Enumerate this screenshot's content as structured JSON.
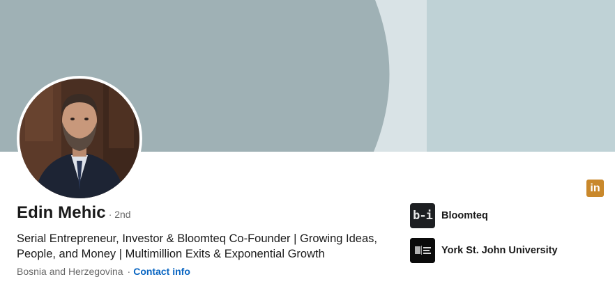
{
  "profile": {
    "name": "Edin Mehic",
    "degree": "· 2nd",
    "headline": "Serial Entrepreneur, Investor & Bloomteq Co-Founder | Growing Ideas, People, and Money | Multimillion Exits & Exponential Growth",
    "location": "Bosnia and Herzegovina",
    "separator": "·",
    "contact_label": "Contact info"
  },
  "badge": {
    "icon": "linkedin-icon",
    "text": "in",
    "color": "#c9882b"
  },
  "organizations": [
    {
      "name": "Bloomteq",
      "logo_icon": "bloomteq-logo",
      "logo_text": "b-i"
    },
    {
      "name": "York St. John University",
      "logo_icon": "york-st-john-logo",
      "logo_text": "YORK ST JOHN UNIVERSITY"
    }
  ],
  "colors": {
    "cover_dark": "#9fb1b5",
    "cover_mid": "#d9e3e6",
    "cover_light": "#bfd2d6",
    "link": "#0a66c2"
  }
}
